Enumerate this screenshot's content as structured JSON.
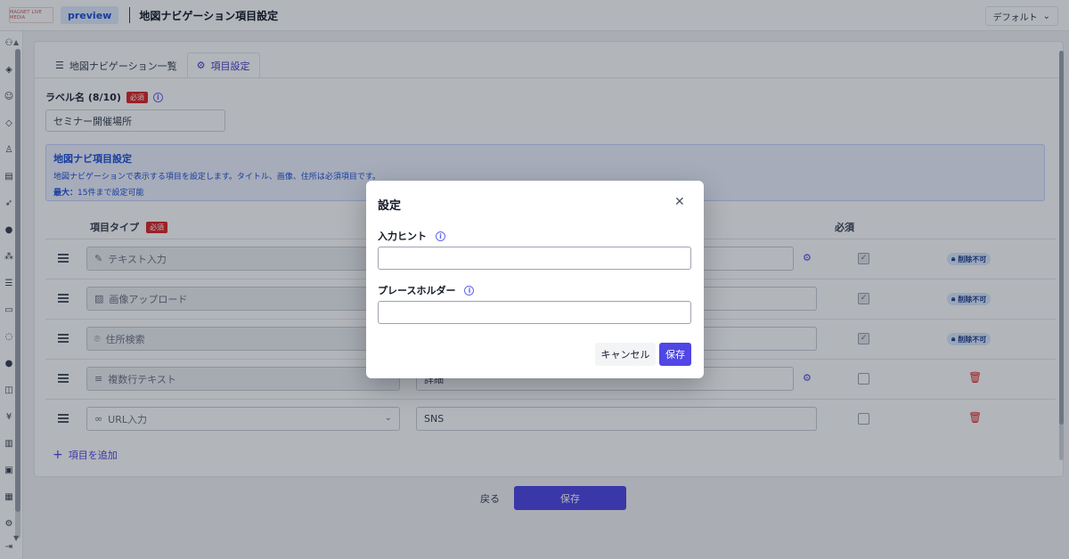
{
  "topbar": {
    "logo_text": "MAGNET LIVE MEDIA",
    "preview_label": "preview",
    "title": "地図ナビゲーション項目設定",
    "default_select": "デフォルト"
  },
  "tabs": [
    {
      "label": "地図ナビゲーション一覧",
      "icon": "list-icon"
    },
    {
      "label": "項目設定",
      "icon": "gear-icon"
    }
  ],
  "label_field": {
    "label": "ラベル名 (8/10)",
    "required_badge": "必須",
    "value": "セミナー開催場所"
  },
  "info_panel": {
    "title": "地図ナビ項目設定",
    "description": "地図ナビゲーションで表示する項目を設定します。タイトル、画像、住所は必須項目です。",
    "max_label": "最大：",
    "max_value": "15件まで設定可能"
  },
  "table": {
    "col_type": "項目タイプ",
    "col_type_badge": "必須",
    "col_required": "必須",
    "rows": [
      {
        "type": "テキスト入力",
        "icon": "pencil-icon",
        "name": "",
        "checked": true,
        "locked": true
      },
      {
        "type": "画像アップロード",
        "icon": "image-icon",
        "name": "",
        "checked": true,
        "locked": true
      },
      {
        "type": "住所検索",
        "icon": "location-pin-icon",
        "name": "",
        "checked": true,
        "locked": true
      },
      {
        "type": "複数行テキスト",
        "icon": "multiline-text-icon",
        "name": "詳細",
        "checked": false,
        "locked": false
      },
      {
        "type": "URL入力",
        "icon": "link-icon",
        "name": "SNS",
        "checked": false,
        "locked": false
      }
    ],
    "lock_label": "削除不可"
  },
  "add_item_label": "項目を追加",
  "footer": {
    "back_label": "戻る",
    "save_label": "保存"
  },
  "modal": {
    "title": "設定",
    "hint_label": "入力ヒント",
    "hint_value": "",
    "placeholder_label": "プレースホルダー",
    "placeholder_value": "",
    "cancel_label": "キャンセル",
    "save_label": "保存"
  },
  "colors": {
    "accent": "#4f46e5",
    "danger": "#dc2626",
    "info_bg": "#eef2ff"
  }
}
